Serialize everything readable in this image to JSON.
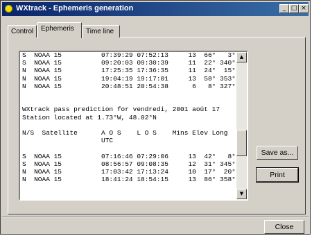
{
  "window": {
    "title": "WXtrack - Ephemeris generation"
  },
  "titlebar_buttons": {
    "minimize": "_",
    "maximize": "□",
    "close": "×"
  },
  "tabs": [
    {
      "label": "Control",
      "active": false
    },
    {
      "label": "Ephemeris",
      "active": true
    },
    {
      "label": "Time line",
      "active": false
    }
  ],
  "ephemeris_listing": [
    "S  NOAA 15          07:39:29 07:52:13     13  66°   3°",
    "S  NOAA 15          09:20:03 09:30:39     11  22° 340°",
    "N  NOAA 15          17:25:35 17:36:35     11  24°  15°",
    "N  NOAA 15          19:04:19 19:17:01     13  58° 353°",
    "N  NOAA 15          20:48:51 20:54:38      6   8° 327°",
    "",
    "",
    "WXtrack pass prediction for vendredi, 2001 août 17",
    "Station located at 1.73°W, 48.02°N",
    "",
    "N/S  Satellite      A O S    L O S    Mins Elev Long",
    "                    UTC",
    "",
    "S  NOAA 15          07:16:46 07:29:06     13  42°   8°",
    "S  NOAA 15          08:56:57 09:08:35     12  31° 345°",
    "N  NOAA 15          17:03:42 17:13:24     10  17°  20°",
    "N  NOAA 15          18:41:24 18:54:15     13  86° 358°"
  ],
  "scroll_glyphs": {
    "up": "▲",
    "down": "▼"
  },
  "buttons": {
    "save": "Save as...",
    "print": "Print",
    "close": "Close"
  },
  "colors": {
    "titlebar_start": "#0a246a",
    "titlebar_end": "#3a6ea5",
    "face": "#d4d0c8"
  }
}
